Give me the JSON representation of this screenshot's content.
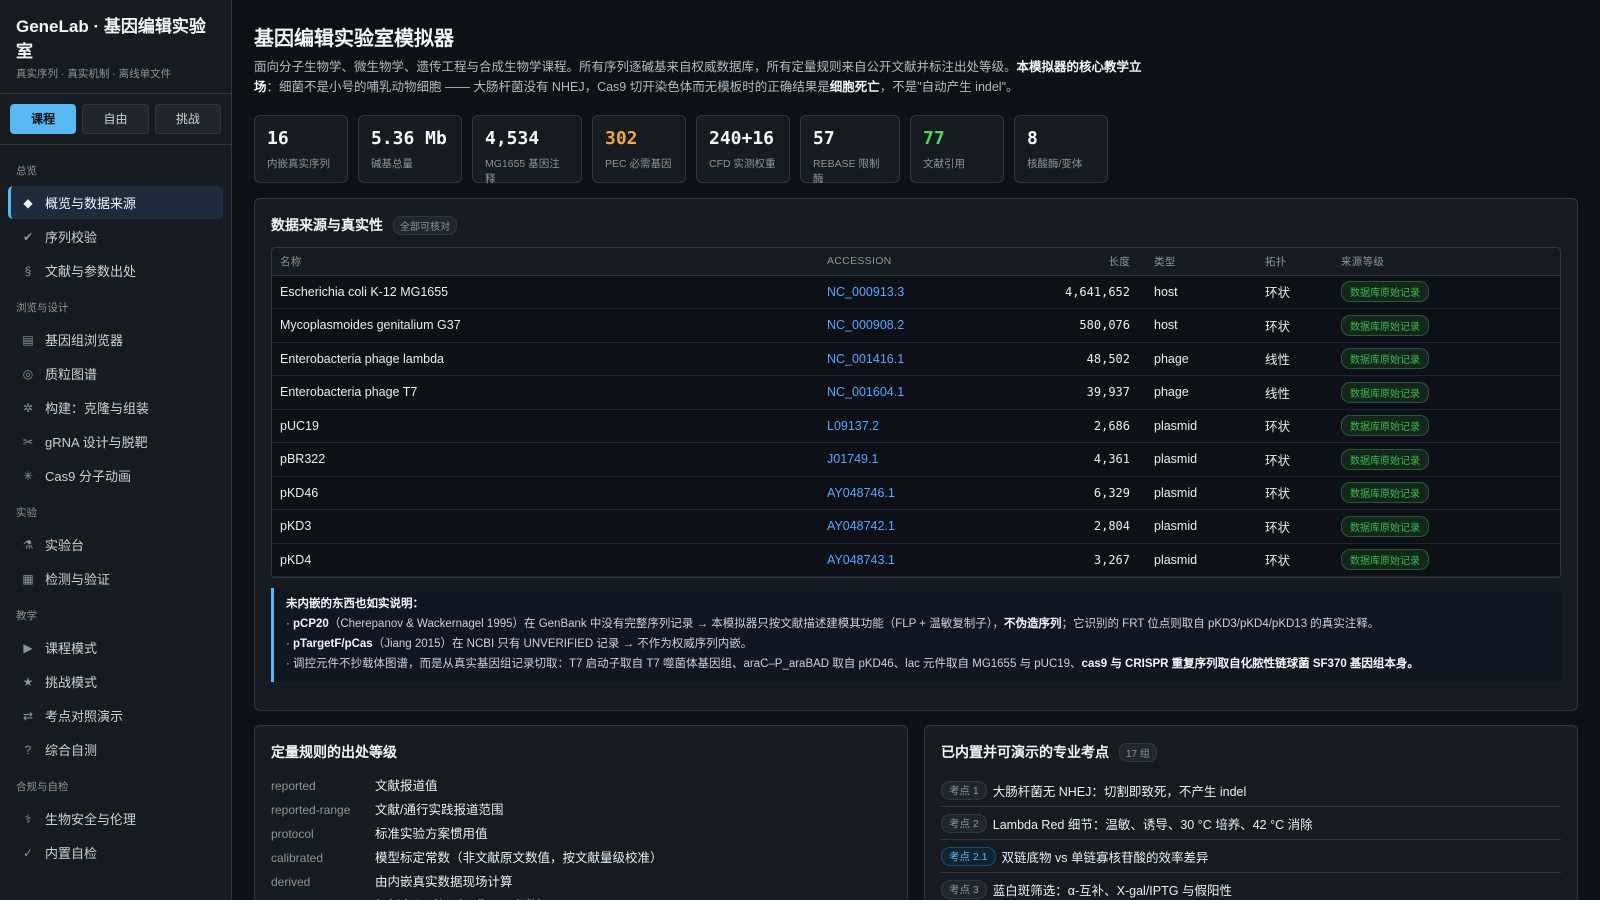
{
  "brand": {
    "title": "GeneLab · 基因编辑实验室",
    "subtitle": "真实序列 · 真实机制 · 离线单文件"
  },
  "mode_tabs": [
    "课程",
    "自由",
    "挑战"
  ],
  "nav": [
    {
      "section": "总览",
      "items": [
        {
          "icon": "◆",
          "icon_name": "diamond-icon",
          "label": "概览与数据来源",
          "active": true
        },
        {
          "icon": "✔",
          "icon_name": "check-icon",
          "label": "序列校验"
        },
        {
          "icon": "§",
          "icon_name": "section-icon",
          "label": "文献与参数出处"
        }
      ]
    },
    {
      "section": "浏览与设计",
      "items": [
        {
          "icon": "▤",
          "icon_name": "genome-icon",
          "label": "基因组浏览器"
        },
        {
          "icon": "◎",
          "icon_name": "plasmid-icon",
          "label": "质粒图谱"
        },
        {
          "icon": "✲",
          "icon_name": "gear-icon",
          "label": "构建：克隆与组装"
        },
        {
          "icon": "✂",
          "icon_name": "scissors-icon",
          "label": "gRNA 设计与脱靶"
        },
        {
          "icon": "✳",
          "icon_name": "molecule-icon",
          "label": "Cas9 分子动画"
        }
      ]
    },
    {
      "section": "实验",
      "items": [
        {
          "icon": "⚗",
          "icon_name": "flask-icon",
          "label": "实验台"
        },
        {
          "icon": "▦",
          "icon_name": "detect-icon",
          "label": "检测与验证"
        }
      ]
    },
    {
      "section": "教学",
      "items": [
        {
          "icon": "▶",
          "icon_name": "play-icon",
          "label": "课程模式"
        },
        {
          "icon": "★",
          "icon_name": "star-icon",
          "label": "挑战模式"
        },
        {
          "icon": "⇄",
          "icon_name": "compare-icon",
          "label": "考点对照演示"
        },
        {
          "icon": "?",
          "icon_name": "question-icon",
          "label": "综合自测"
        }
      ]
    },
    {
      "section": "合规与自检",
      "items": [
        {
          "icon": "⚕",
          "icon_name": "biosafety-icon",
          "label": "生物安全与伦理"
        },
        {
          "icon": "✓",
          "icon_name": "selfcheck-icon",
          "label": "内置自检"
        }
      ]
    }
  ],
  "header": {
    "title": "基因编辑实验室模拟器",
    "desc_1": "面向分子生物学、微生物学、遗传工程与合成生物学课程。所有序列逐碱基来自权威数据库，所有定量规则来自公开文献并标注出处等级。",
    "desc_bold_1": "本模拟器的核心教学立场",
    "desc_2": "：细菌不是小号的哺乳动物细胞 —— 大肠杆菌没有 NHEJ，Cas9 切开染色体而无模板时的正确结果是",
    "desc_bold_2": "细胞死亡",
    "desc_3": "，不是\"自动产生 indel\"。"
  },
  "stats": [
    {
      "value": "16",
      "label": "内嵌真实序列",
      "color": "#f0f6fc"
    },
    {
      "value": "5.36 Mb",
      "label": "碱基总量",
      "color": "#f0f6fc"
    },
    {
      "value": "4,534",
      "label": "MG1655 基因注释",
      "color": "#f0f6fc"
    },
    {
      "value": "302",
      "label": "PEC 必需基因",
      "color": "#f0a742"
    },
    {
      "value": "240+16",
      "label": "CFD 实测权重",
      "color": "#f0f6fc"
    },
    {
      "value": "57",
      "label": "REBASE 限制酶",
      "color": "#f0f6fc"
    },
    {
      "value": "77",
      "label": "文献引用",
      "color": "#56d364"
    },
    {
      "value": "8",
      "label": "核酸酶/变体",
      "color": "#f0f6fc"
    }
  ],
  "sources": {
    "title": "数据来源与真实性",
    "badge": "全部可核对",
    "columns": [
      "名称",
      "ACCESSION",
      "长度",
      "类型",
      "拓扑",
      "来源等级"
    ],
    "rows": [
      [
        "Escherichia coli K-12 MG1655",
        "NC_000913.3",
        "4,641,652",
        "host",
        "环状",
        "数据库原始记录"
      ],
      [
        "Mycoplasmoides genitalium G37",
        "NC_000908.2",
        "580,076",
        "host",
        "环状",
        "数据库原始记录"
      ],
      [
        "Enterobacteria phage lambda",
        "NC_001416.1",
        "48,502",
        "phage",
        "线性",
        "数据库原始记录"
      ],
      [
        "Enterobacteria phage T7",
        "NC_001604.1",
        "39,937",
        "phage",
        "线性",
        "数据库原始记录"
      ],
      [
        "pUC19",
        "L09137.2",
        "2,686",
        "plasmid",
        "环状",
        "数据库原始记录"
      ],
      [
        "pBR322",
        "J01749.1",
        "4,361",
        "plasmid",
        "环状",
        "数据库原始记录"
      ],
      [
        "pKD46",
        "AY048746.1",
        "6,329",
        "plasmid",
        "环状",
        "数据库原始记录"
      ],
      [
        "pKD3",
        "AY048742.1",
        "2,804",
        "plasmid",
        "环状",
        "数据库原始记录"
      ],
      [
        "pKD4",
        "AY048743.1",
        "3,267",
        "plasmid",
        "环状",
        "数据库原始记录"
      ]
    ],
    "note_title": "未内嵌的东西也如实说明：",
    "note_1a": "· ",
    "note_1b": "pCP20",
    "note_1c": "（Cherepanov & Wackernagel 1995）在 GenBank 中没有完整序列记录 → 本模拟器只按文献描述建模其功能（FLP + 温敏复制子），",
    "note_1d": "不伪造序列",
    "note_1e": "；它识别的 FRT 位点则取自 pKD3/pKD4/pKD13 的真实注释。",
    "note_2a": "· ",
    "note_2b": "pTargetF/pCas",
    "note_2c": "（Jiang 2015）在 NCBI 只有 UNVERIFIED 记录 → 不作为权威序列内嵌。",
    "note_3a": "· 调控元件不抄载体图谱，而是从真实基因组记录切取：T7 启动子取自 T7 噬菌体基因组、araC–P_araBAD 取自 pKD46、lac 元件取自 MG1655 与 pUC19、",
    "note_3b": "cas9 与 CRISPR 重复序列取自化脓性链球菌 SF370 基因组本身。"
  },
  "rules": {
    "title": "定量规则的出处等级",
    "rows": [
      {
        "key": "reported",
        "val": "文献报道值"
      },
      {
        "key": "reported-range",
        "val": "文献/通行实践报道范围"
      },
      {
        "key": "protocol",
        "val": "标准实验方案惯用值"
      },
      {
        "key": "calibrated",
        "val": "模型标定常数（非文献原文数值，按文献量级校准）"
      },
      {
        "key": "derived",
        "val": "由内嵌真实数据现场计算"
      },
      {
        "key": "definition",
        "val": "机制定义（规则，非可调参数）"
      }
    ]
  },
  "points": {
    "title": "已内置并可演示的专业考点",
    "badge": "17 组",
    "rows": [
      {
        "tag": "考点 1",
        "text": "大肠杆菌无 NHEJ：切割即致死，不产生 indel",
        "cyan": false
      },
      {
        "tag": "考点 2",
        "text": "Lambda Red 细节：温敏、诱导、30 °C 培养、42 °C 消除",
        "cyan": false
      },
      {
        "tag": "考点 2.1",
        "text": "双链底物 vs 单链寡核苷酸的效率差异",
        "cyan": true
      },
      {
        "tag": "考点 3",
        "text": "蓝白斑筛选：α-互补、X-gal/IPTG 与假阳性",
        "cyan": false
      }
    ]
  }
}
